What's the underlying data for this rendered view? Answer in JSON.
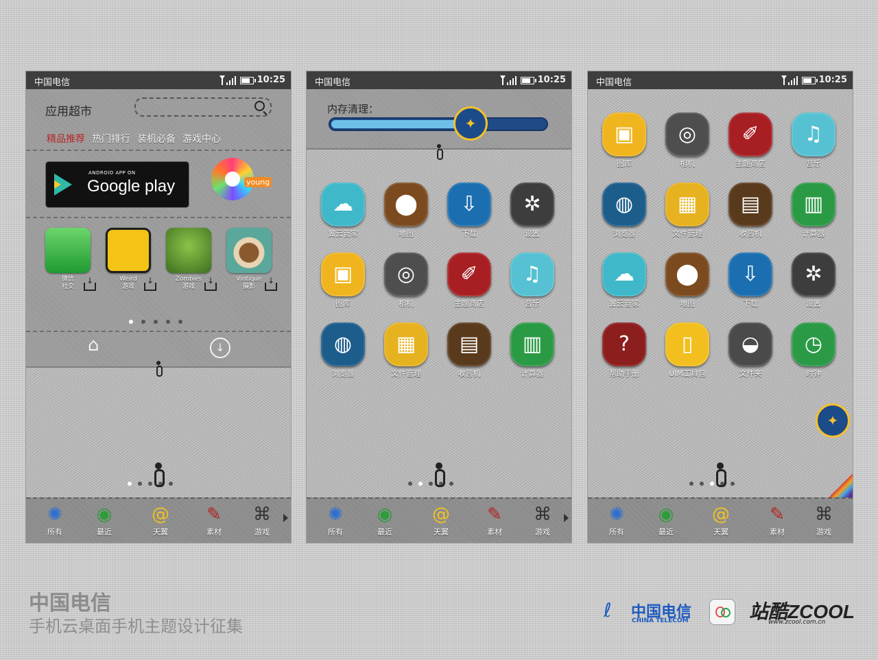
{
  "status": {
    "carrier": "中国电信",
    "time": "10:25"
  },
  "phone1": {
    "store_title": "应用超市",
    "tabs": [
      "精品推荐",
      "热门排行",
      "装机必备",
      "游戏中心"
    ],
    "google_play_small": "ANDROID APP ON",
    "google_play_big": "Google play",
    "young_label": "young",
    "apps": [
      {
        "name": "微信",
        "category": "社交"
      },
      {
        "name": "Weird",
        "category": "游戏"
      },
      {
        "name": "Zombies",
        "category": "游戏"
      },
      {
        "name": "Vintique",
        "category": "摄影"
      }
    ]
  },
  "phone2": {
    "memory_label": "内存清理：",
    "memory_level": 0.6,
    "apps": [
      "翼云管家",
      "地图",
      "下载",
      "设置",
      "图库",
      "相机",
      "主题商店",
      "音乐",
      "浏览器",
      "文件管理",
      "收音机",
      "计算器"
    ]
  },
  "phone3": {
    "apps": [
      "图库",
      "相机",
      "主题商店",
      "音乐",
      "浏览器",
      "文件管理",
      "收音机",
      "计算器",
      "翼云管家",
      "地图",
      "下载",
      "设置",
      "帮助手册",
      "UIM工具包",
      "文件夹",
      "时钟"
    ]
  },
  "dock": [
    "所有",
    "最近",
    "天翼",
    "素材",
    "游戏"
  ],
  "footer": {
    "title": "中国电信",
    "subtitle": "手机云桌面手机主题设计征集",
    "ct_name": "中国电信",
    "ct_en": "CHINA TELECOM",
    "zcool": "站酷ZCOOL",
    "zcool_url": "www.zcool.com.cn"
  },
  "colors": {
    "tab_active": "#b8282a",
    "status_bar": "#3e3e3e",
    "ct_blue": "#1e5bbf",
    "cleaner_ring": "#f5c12a"
  }
}
